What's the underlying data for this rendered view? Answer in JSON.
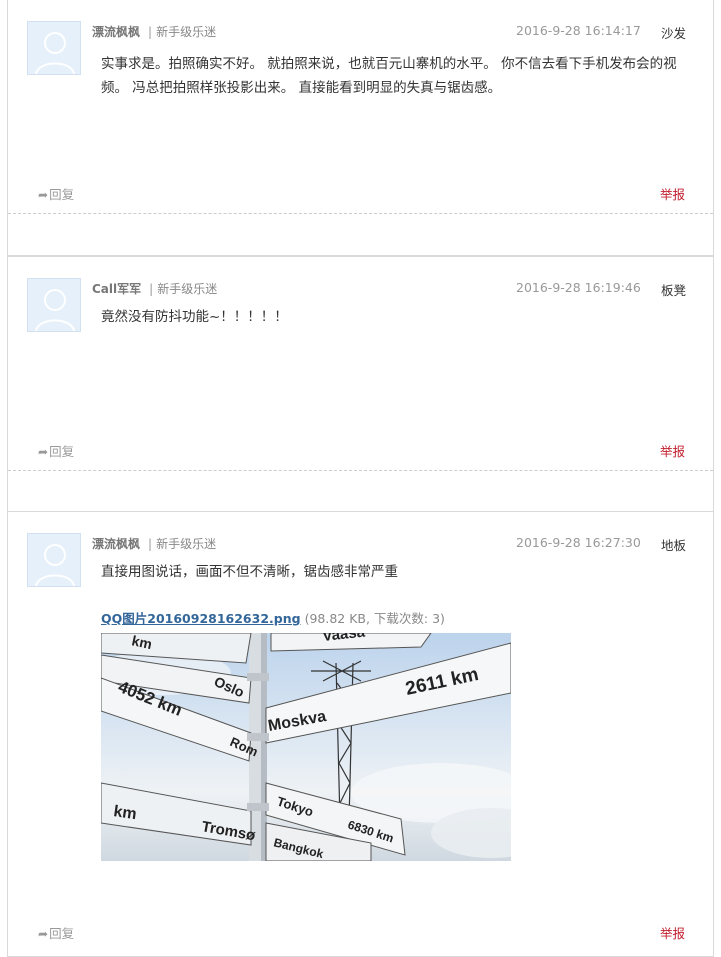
{
  "comments": [
    {
      "author": "漂流枫枫",
      "level": "新手级乐迷",
      "time": "2016-9-28 16:14:17",
      "floor": "沙发",
      "content": "实事求是。拍照确实不好。 就拍照来说，也就百元山寨机的水平。 你不信去看下手机发布会的视频。 冯总把拍照样张投影出来。 直接能看到明显的失真与锯齿感。",
      "reply_label": "回复",
      "report_label": "举报"
    },
    {
      "author": "Call军军",
      "level": "新手级乐迷",
      "time": "2016-9-28 16:19:46",
      "floor": "板凳",
      "content": "竟然没有防抖功能~！！！！！",
      "reply_label": "回复",
      "report_label": "举报"
    },
    {
      "author": "漂流枫枫",
      "level": "新手级乐迷",
      "time": "2016-9-28 16:27:30",
      "floor": "地板",
      "content": "直接用图说话，画面不但不清晰，锯齿感非常严重",
      "attachment": {
        "filename": "QQ图片20160928162632.png",
        "info": "(98.82 KB, 下载次数: 3)"
      },
      "photo_signs": {
        "top": "Vaasa",
        "oslo": "Oslo",
        "dist_left": "4052 km",
        "rom": "Rom",
        "dist_big": "2611 km",
        "moskva": "Moskva",
        "km_left": "km",
        "tromso": "Tromsø",
        "tokyo": "Tokyo",
        "dist_tokyo": "6830 km",
        "bangkok": "Bangkok",
        "km_top_left": "km"
      },
      "reply_label": "回复",
      "report_label": "举报"
    }
  ],
  "colors": {
    "report": "#c0202e",
    "link": "#336699",
    "muted": "#999999"
  }
}
